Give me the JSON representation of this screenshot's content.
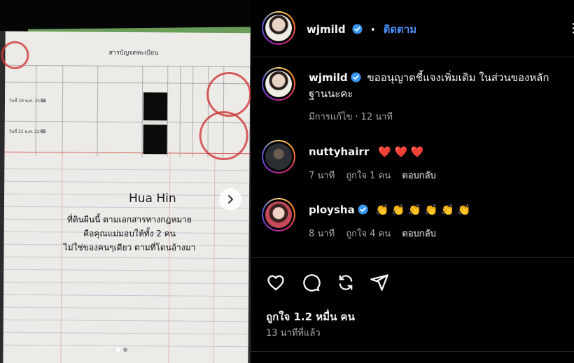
{
  "post": {
    "image": {
      "doc_heading": "สารบัญจดทะเบียน",
      "caption_title": "Hua Hin",
      "caption_lines": [
        "ที่ดินผืนนี้ ตามเอกสารทางกฎหมาย",
        "คือคุณแม่มอบให้ทั้ง 2 คน",
        "ไม่ใช่ของคนๆเดียว ตามที่โดนอ้างมา"
      ],
      "rows": [
        {
          "date": "วันที่ 29 พ.ศ. 2544",
          "label": "ให้"
        },
        {
          "date": "วันที่ 25 พ.ศ. 2545",
          "label": "ให้"
        }
      ],
      "carousel": {
        "current": 1,
        "total": 2
      }
    },
    "header": {
      "username": "wjmild",
      "separator": "•",
      "follow_label": "ติดตาม",
      "more_label": "⋮"
    },
    "caption_comment": {
      "username": "wjmild",
      "text": "ขออนุญาตชี้แจงเพิ่มเติม ในส่วนของหลักฐานนะคะ",
      "edited_label": "มีการแก้ไข",
      "time": "12 นาที"
    },
    "comments": [
      {
        "username": "nuttyhairr",
        "verified": false,
        "text": "❤️ ❤️ ❤️",
        "time": "7 นาที",
        "likes": "ถูกใจ 1 คน",
        "reply_label": "ตอบกลับ"
      },
      {
        "username": "ploysha",
        "verified": true,
        "text": "👏 👏 👏 👏 👏 👏",
        "time": "8 นาที",
        "likes": "ถูกใจ 4 คน",
        "reply_label": "ตอบกลับ"
      }
    ],
    "likes_total": "ถูกใจ 1.2 หมื่น คน",
    "posted_time": "13 นาทีที่แล้ว",
    "colors": {
      "accent": "#4a8ff7",
      "verified": "#3897f0",
      "background": "#000000",
      "muted": "#a8a8a8"
    },
    "icons": [
      "heart-icon",
      "comment-icon",
      "repost-icon",
      "share-icon",
      "chevron-right-icon",
      "verified-icon"
    ]
  }
}
